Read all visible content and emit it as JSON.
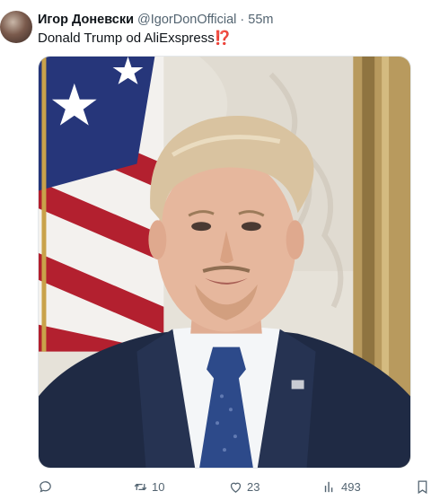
{
  "tweet": {
    "author_name": "Игор Доневски",
    "author_handle": "@IgorDonOfficial",
    "separator": "·",
    "time": "55m",
    "text": "Donald Trump od AliExspress",
    "text_emoji": "⁉️",
    "media_description": "Edited photo of a man in a navy suit in front of an American flag"
  },
  "actions": {
    "replies": "",
    "retweets": "10",
    "likes": "23",
    "views": "493"
  },
  "colors": {
    "text_primary": "#0f1419",
    "text_secondary": "#536471",
    "emoji_red": "#d6203a"
  }
}
